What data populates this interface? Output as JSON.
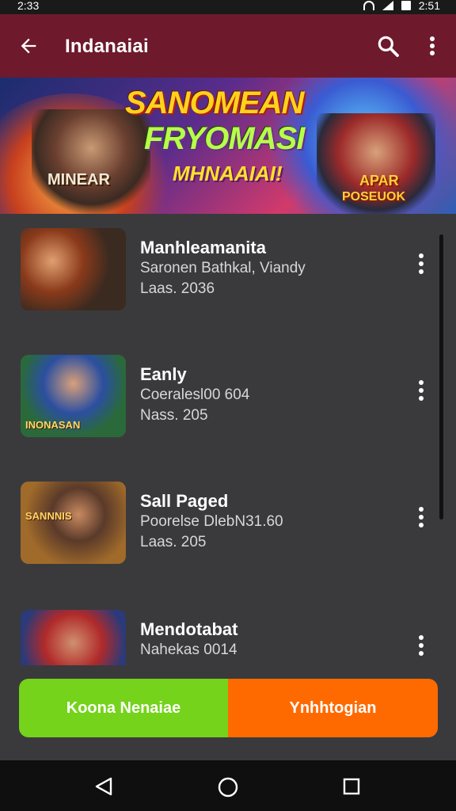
{
  "status_bar": {
    "time_left": "2:33",
    "time_right": "2:51"
  },
  "app_bar": {
    "title": "Indanaiai",
    "icons": [
      "back-arrow-icon",
      "search-icon",
      "more-vert-icon"
    ]
  },
  "banner": {
    "title_line1": "SANOMEAN",
    "title_line2": "FRYOMASI",
    "subtitle": "MHNAAIAI!",
    "left_caption": "MINEAR",
    "right_caption_top": "APAR",
    "right_caption_bottom": "POSEUOK"
  },
  "games": [
    {
      "name": "Manhleamanita",
      "line2": "Saronen Bathkal, Viandy",
      "line3": "Laas. 2036",
      "thumb_caption": ""
    },
    {
      "name": "Eanly",
      "line2": "Coeralesl00 604",
      "line3": "Nass. 205",
      "thumb_caption": "INONASAN"
    },
    {
      "name": "Sall Paged",
      "line2": "Poorelse DlebN31.60",
      "line3": "Laas. 205",
      "thumb_caption": "SANNNIS"
    },
    {
      "name": "Mendotabat",
      "line2": "Nahekas 0014",
      "line3": "",
      "thumb_caption": ""
    }
  ],
  "actions": {
    "left_label": "Koona Nenaiae",
    "right_label": "Ynhhtogian"
  },
  "colors": {
    "app_bar": "#6e1a2c",
    "background": "#3a3a3c",
    "left_button": "#74d31a",
    "right_button": "#ff6a00"
  }
}
